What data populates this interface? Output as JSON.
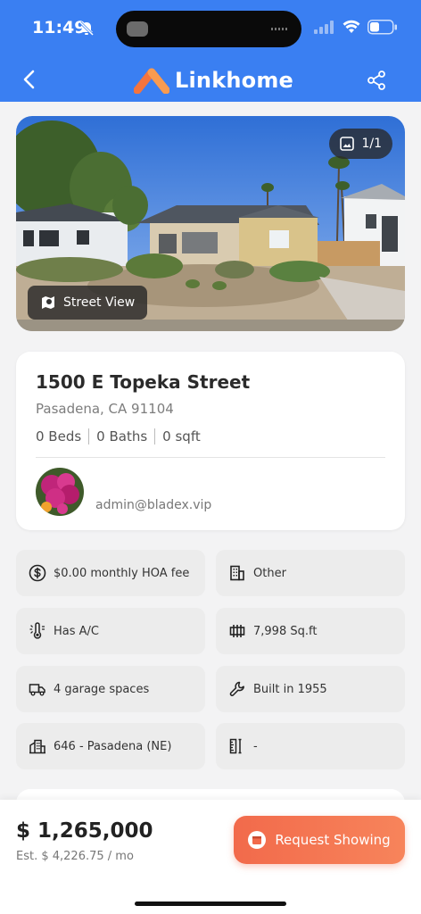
{
  "status_bar": {
    "time": "11:49"
  },
  "header": {
    "brand": "Linkhome"
  },
  "photo": {
    "counter": "1/1",
    "street_view_label": "Street View"
  },
  "listing": {
    "address": "1500 E Topeka Street",
    "city_state_zip": "Pasadena, CA 91104",
    "beds": "0 Beds",
    "baths": "0 Baths",
    "sqft": "0 sqft",
    "agent_email": "admin@bladex.vip"
  },
  "features": [
    {
      "icon": "dollar-icon",
      "label": "$0.00 monthly HOA fee"
    },
    {
      "icon": "building-icon",
      "label": "Other"
    },
    {
      "icon": "thermometer-icon",
      "label": "Has A/C"
    },
    {
      "icon": "lot-icon",
      "label": "7,998 Sq.ft"
    },
    {
      "icon": "truck-icon",
      "label": "4 garage spaces"
    },
    {
      "icon": "wrench-icon",
      "label": "Built in 1955"
    },
    {
      "icon": "city-icon",
      "label": "646 - Pasadena (NE)"
    },
    {
      "icon": "ruler-icon",
      "label": "-"
    }
  ],
  "bottom_bar": {
    "price": "$ 1,265,000",
    "estimate": "Est. $ 4,226.75 / mo",
    "request_label": "Request Showing"
  },
  "colors": {
    "header_blue": "#3a7ff2",
    "accent_orange": "#f26a4b"
  }
}
